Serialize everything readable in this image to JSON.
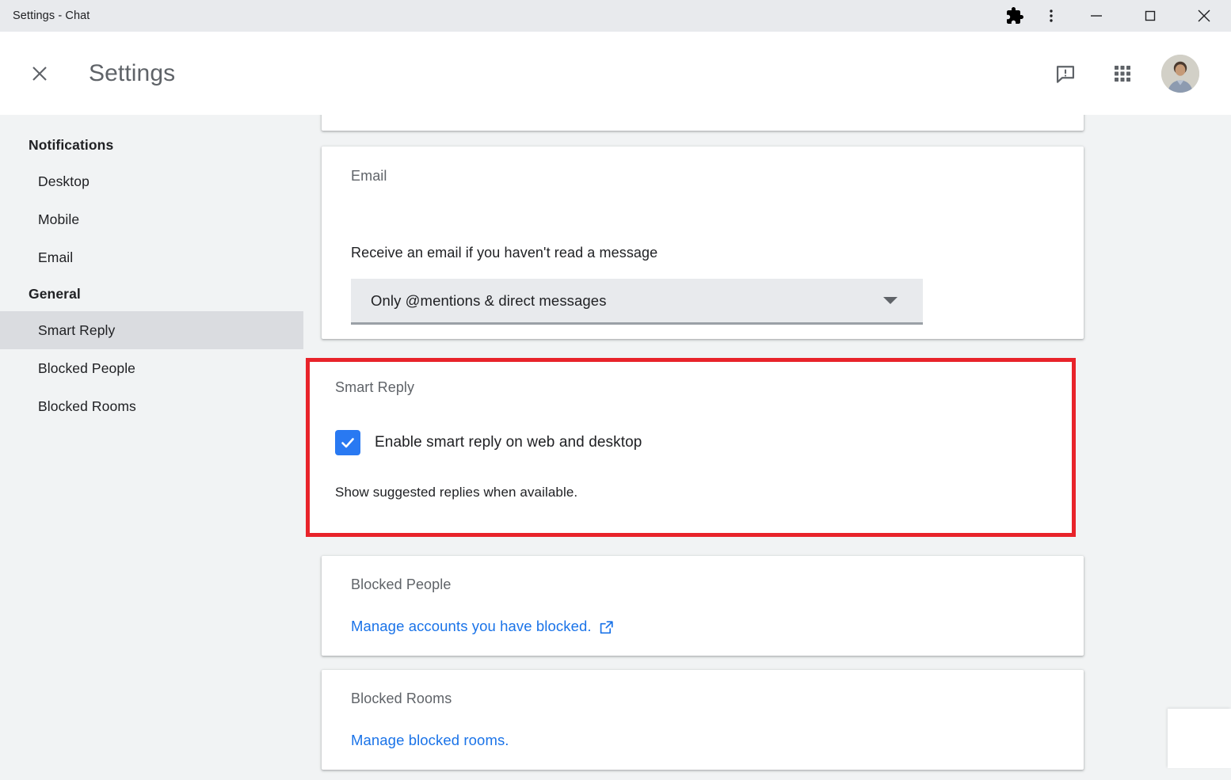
{
  "window": {
    "title": "Settings - Chat",
    "controls": {
      "extensions": "extensions-puzzle-icon",
      "menu": "three-dot-menu-icon",
      "minimize": "minimize-icon",
      "maximize": "maximize-icon",
      "close": "close-icon"
    }
  },
  "header": {
    "close_label": "close-icon",
    "title": "Settings",
    "feedback_icon": "feedback-icon",
    "apps_icon": "apps-grid-icon",
    "avatar": "account-avatar"
  },
  "sidebar": {
    "groups": [
      {
        "label": "Notifications",
        "items": [
          {
            "label": "Desktop",
            "selected": false
          },
          {
            "label": "Mobile",
            "selected": false
          },
          {
            "label": "Email",
            "selected": false
          }
        ]
      },
      {
        "label": "General",
        "items": [
          {
            "label": "Smart Reply",
            "selected": true
          },
          {
            "label": "Blocked People",
            "selected": false
          },
          {
            "label": "Blocked Rooms",
            "selected": false
          }
        ]
      }
    ]
  },
  "content": {
    "email_card": {
      "title": "Email",
      "description": "Receive an email if you haven't read a message",
      "select_value": "Only @mentions & direct messages",
      "select_options": [
        "Only @mentions & direct messages"
      ]
    },
    "smart_reply_card": {
      "title": "Smart Reply",
      "checkbox_label": "Enable smart reply on web and desktop",
      "checkbox_checked": true,
      "helper_text": "Show suggested replies when available.",
      "highlight_color": "#e8232a"
    },
    "blocked_people_card": {
      "title": "Blocked People",
      "link_text": "Manage accounts you have blocked.",
      "link_icon": "external-link-icon"
    },
    "blocked_rooms_card": {
      "title": "Blocked Rooms",
      "link_text": "Manage blocked rooms."
    }
  },
  "colors": {
    "accent_blue": "#1a73e8",
    "checkbox_blue": "#2979f2",
    "highlight_red": "#e8232a",
    "sidebar_bg": "#f1f3f4",
    "selected_bg": "#dadce0",
    "titlebar_bg": "#e8eaed"
  }
}
